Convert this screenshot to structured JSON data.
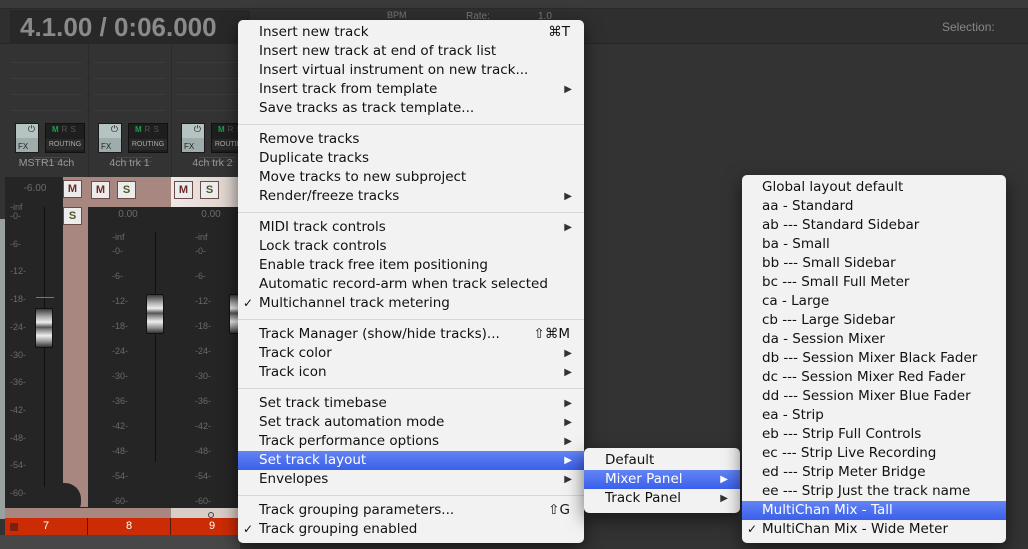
{
  "transport": {
    "time_display": "4.1.00 / 0:06.000",
    "bpm_label": "BPM",
    "rate_label": "Rate:",
    "rate_value": "1.0",
    "selection_label": "Selection:"
  },
  "mixer": {
    "strips": [
      {
        "name": "MSTR1 4ch",
        "fx_label": "FX",
        "routing_label": "ROUTING",
        "mrs": [
          "M",
          "R",
          "S"
        ],
        "mute_label": "M",
        "solo_label": "S",
        "volume": "-6.00",
        "scale": [
          "-inf",
          "-0-",
          "-6-",
          "-12-",
          "-18-",
          "-24-",
          "-30-",
          "-36-",
          "-42-",
          "-48-",
          "-54-",
          "-60-"
        ],
        "number": "7",
        "color": "#a7877f"
      },
      {
        "name": "4ch trk 1",
        "fx_label": "FX",
        "routing_label": "ROUTING",
        "mrs": [
          "M",
          "R",
          "S"
        ],
        "mute_label": "M",
        "solo_label": "S",
        "volume": "0.00",
        "scale": [
          "-inf",
          "-0-",
          "-6-",
          "-12-",
          "-18-",
          "-24-",
          "-30-",
          "-36-",
          "-42-",
          "-48-",
          "-54-",
          "-60-"
        ],
        "number": "8",
        "color": "#a7877f"
      },
      {
        "name": "4ch trk 2",
        "fx_label": "FX",
        "routing_label": "ROUTING",
        "mrs": [
          "M",
          "R",
          "S"
        ],
        "mute_label": "M",
        "solo_label": "S",
        "volume": "0.00",
        "scale": [
          "-inf",
          "-0-",
          "-6-",
          "-12-",
          "-18-",
          "-24-",
          "-30-",
          "-36-",
          "-42-",
          "-48-",
          "-54-",
          "-60-"
        ],
        "number": "9",
        "color": "#d9cdc8"
      }
    ]
  },
  "context_menu": {
    "groups": [
      [
        {
          "label": "Insert new track",
          "shortcut": "⌘T"
        },
        {
          "label": "Insert new track at end of track list"
        },
        {
          "label": "Insert virtual instrument on new track..."
        },
        {
          "label": "Insert track from template",
          "submenu": true
        },
        {
          "label": "Save tracks as track template..."
        }
      ],
      [
        {
          "label": "Remove tracks"
        },
        {
          "label": "Duplicate tracks"
        },
        {
          "label": "Move tracks to new subproject"
        },
        {
          "label": "Render/freeze tracks",
          "submenu": true
        }
      ],
      [
        {
          "label": "MIDI track controls",
          "submenu": true
        },
        {
          "label": "Lock track controls"
        },
        {
          "label": "Enable track free item positioning"
        },
        {
          "label": "Automatic record-arm when track selected"
        },
        {
          "label": "Multichannel track metering",
          "checked": true
        }
      ],
      [
        {
          "label": "Track Manager (show/hide tracks)...",
          "shortcut": "⇧⌘M"
        },
        {
          "label": "Track color",
          "submenu": true
        },
        {
          "label": "Track icon",
          "submenu": true
        }
      ],
      [
        {
          "label": "Set track timebase",
          "submenu": true
        },
        {
          "label": "Set track automation mode",
          "submenu": true
        },
        {
          "label": "Track performance options",
          "submenu": true
        },
        {
          "label": "Set track layout",
          "submenu": true,
          "highlighted": true
        },
        {
          "label": "Envelopes",
          "submenu": true
        }
      ],
      [
        {
          "label": "Track grouping parameters...",
          "shortcut": "⇧G"
        },
        {
          "label": "Track grouping enabled",
          "checked": true
        }
      ]
    ]
  },
  "layout_submenu": {
    "items": [
      {
        "label": "Default"
      },
      {
        "label": "Mixer Panel",
        "submenu": true,
        "highlighted": true
      },
      {
        "label": "Track Panel",
        "submenu": true
      }
    ]
  },
  "mixer_panel_submenu": {
    "items": [
      {
        "label": "Global layout default"
      },
      {
        "label": "aa - Standard"
      },
      {
        "label": "ab --- Standard Sidebar"
      },
      {
        "label": "ba - Small"
      },
      {
        "label": "bb --- Small Sidebar"
      },
      {
        "label": "bc --- Small Full Meter"
      },
      {
        "label": "ca - Large"
      },
      {
        "label": "cb --- Large Sidebar"
      },
      {
        "label": "da - Session Mixer"
      },
      {
        "label": "db --- Session Mixer Black Fader"
      },
      {
        "label": "dc --- Session Mixer Red Fader"
      },
      {
        "label": "dd --- Session Mixer Blue Fader"
      },
      {
        "label": "ea - Strip"
      },
      {
        "label": "eb --- Strip Full Controls"
      },
      {
        "label": "ec --- Strip Live Recording"
      },
      {
        "label": "ed --- Strip Meter Bridge"
      },
      {
        "label": "ee --- Strip Just the track name"
      },
      {
        "label": "MultiChan Mix - Tall",
        "highlighted": true
      },
      {
        "label": "MultiChan Mix - Wide Meter",
        "checked": true
      }
    ]
  },
  "icons": {
    "check": "✓",
    "submenu_arrow": "▶",
    "power": "⏻"
  },
  "colors": {
    "highlight": "#3a5fea",
    "track_number_bar": "#cc2c05",
    "mute_text": "#6d2a28",
    "routing_m": "#1aa04c"
  }
}
